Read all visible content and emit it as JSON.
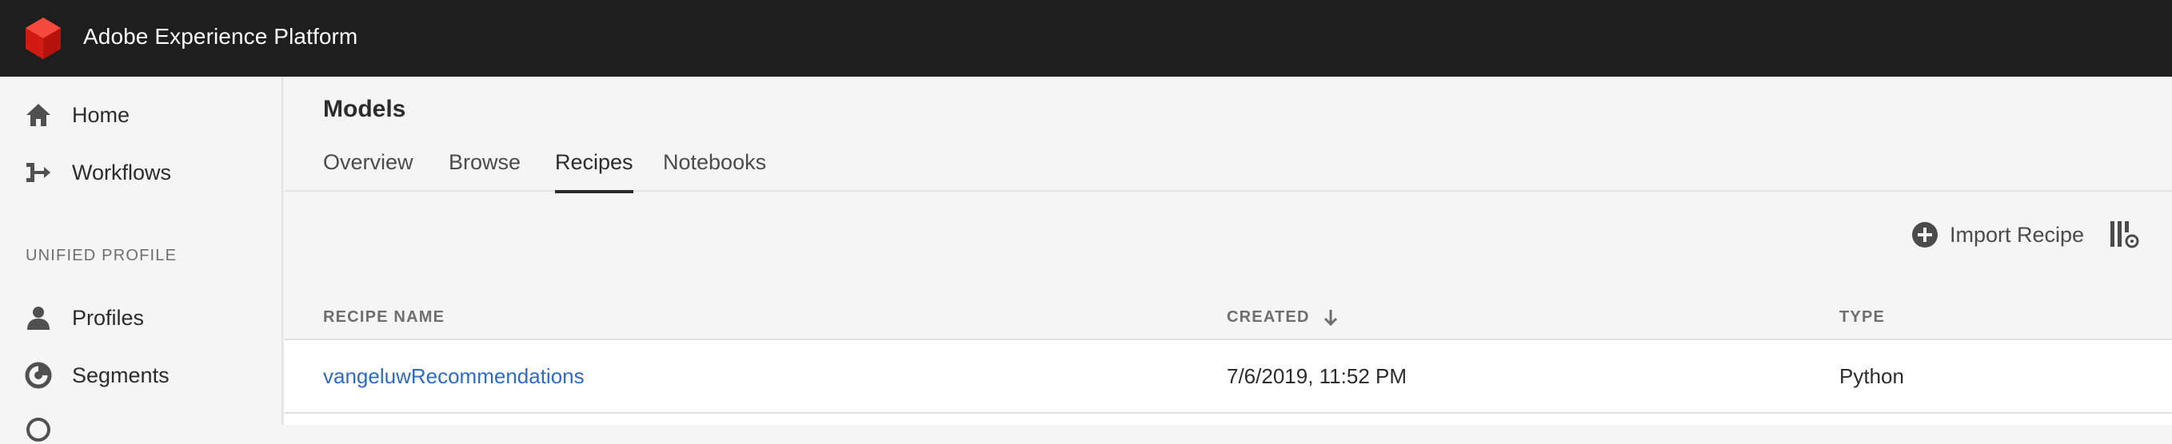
{
  "header": {
    "app_title": "Adobe Experience Platform",
    "logo_icon": "adobe-logo-icon",
    "brand_color": "#e0271b"
  },
  "sidebar": {
    "items": [
      {
        "label": "Home",
        "icon": "home-icon"
      },
      {
        "label": "Workflows",
        "icon": "workflows-icon"
      },
      {
        "label": "Profiles",
        "icon": "user-icon"
      },
      {
        "label": "Segments",
        "icon": "segments-icon"
      }
    ],
    "section_label": "UNIFIED PROFILE"
  },
  "main": {
    "title": "Models",
    "tabs": [
      {
        "label": "Overview",
        "active": false
      },
      {
        "label": "Browse",
        "active": false
      },
      {
        "label": "Recipes",
        "active": true
      },
      {
        "label": "Notebooks",
        "active": false
      }
    ],
    "toolbar": {
      "import_label": "Import Recipe",
      "import_icon": "add-circle-icon",
      "settings_icon": "column-settings-icon"
    },
    "table": {
      "columns": [
        "RECIPE NAME",
        "CREATED",
        "TYPE"
      ],
      "sort_icon": "arrow-down-icon",
      "rows": [
        {
          "name": "vangeluwRecommendations",
          "created": "7/6/2019, 11:52 PM",
          "type": "Python"
        }
      ]
    }
  }
}
